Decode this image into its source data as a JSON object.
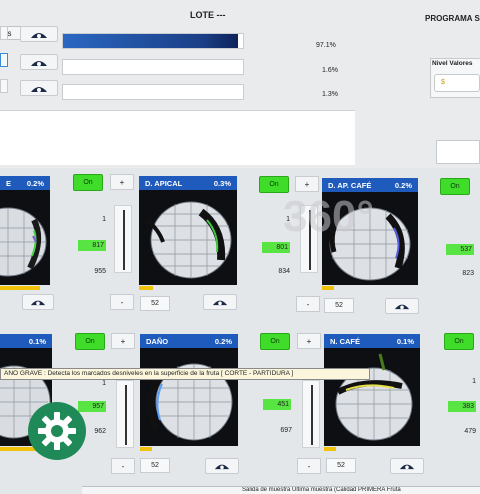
{
  "header": {
    "lote_title": "LOTE ---",
    "programa_title": "PROGRAMA S",
    "tab_label": "es"
  },
  "progress_rows": [
    {
      "value_label": "97.1%",
      "fill": 0.97
    },
    {
      "value_label": "1.6%",
      "fill": 0.0
    },
    {
      "value_label": "1.3%",
      "fill": 0.0
    }
  ],
  "nivel": {
    "label": "Nivel Valores",
    "value": "$"
  },
  "watermark": "360°",
  "cards": [
    {
      "title": "E",
      "pct": "0.2%",
      "on_label": "On",
      "plus": "+",
      "minus": "-",
      "count": "52",
      "v1": "1",
      "v2": "817",
      "v3": "955"
    },
    {
      "title": "D. APICAL",
      "pct": "0.3%",
      "on_label": "On",
      "plus": "+",
      "minus": "-",
      "count": "52",
      "v1": "1",
      "v2": "801",
      "v3": "834"
    },
    {
      "title": "D. AP. CAFÉ",
      "pct": "0.2%",
      "on_label": "On",
      "plus": "+",
      "minus": "-",
      "count": "52",
      "v1": "1",
      "v2": "537",
      "v3": "823"
    },
    {
      "title": "",
      "pct": "0.1%",
      "on_label": "On",
      "plus": "+",
      "minus": "-",
      "count": "52",
      "v1": "1",
      "v2": "957",
      "v3": "962"
    },
    {
      "title": "DAÑO",
      "pct": "0.2%",
      "on_label": "On",
      "plus": "+",
      "minus": "-",
      "count": "52",
      "v1": "1",
      "v2": "451",
      "v3": "697"
    },
    {
      "title": "N. CAFÉ",
      "pct": "0.1%",
      "on_label": "On",
      "plus": "+",
      "minus": "-",
      "count": "52",
      "v1": "1",
      "v2": "383",
      "v3": "479"
    }
  ],
  "tooltip": "ANO GRAVE : Detecta los marcados desniveles en la superficie de la fruta [ CORTE - PARTIDURA ]",
  "status_bar": "Salida de muestra   Ultima muestra (Calidad  PRIMERA   Fruta"
}
